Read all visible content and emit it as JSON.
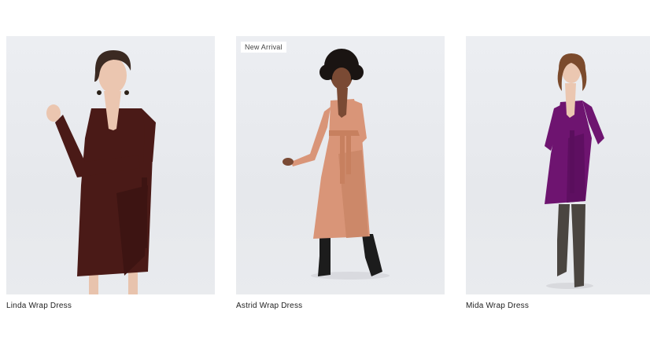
{
  "products": [
    {
      "name": "Linda Wrap Dress",
      "badge": "",
      "dress_color": "#4a1a17"
    },
    {
      "name": "Astrid Wrap Dress",
      "badge": "New Arrival",
      "dress_color": "#d99578"
    },
    {
      "name": "Mida Wrap Dress",
      "badge": "",
      "dress_color": "#6e1470"
    }
  ]
}
